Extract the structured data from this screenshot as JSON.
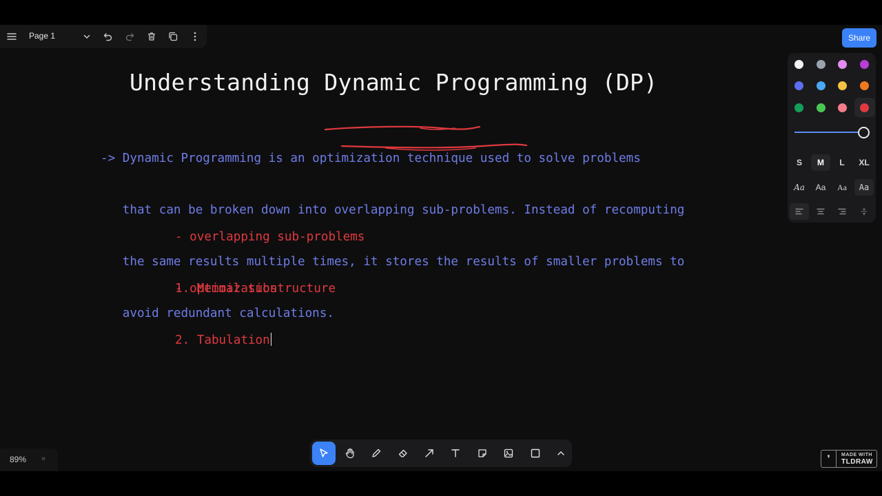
{
  "menu": {
    "page_name": "Page 1"
  },
  "share": {
    "label": "Share"
  },
  "style_panel": {
    "colors": [
      {
        "name": "white",
        "hex": "#f2f2f2"
      },
      {
        "name": "grey",
        "hex": "#9ca3af"
      },
      {
        "name": "light-violet",
        "hex": "#e28cf0"
      },
      {
        "name": "violet",
        "hex": "#b83ed6"
      },
      {
        "name": "blue",
        "hex": "#5e6ef0"
      },
      {
        "name": "light-blue",
        "hex": "#4aa9f5"
      },
      {
        "name": "yellow",
        "hex": "#f5c242"
      },
      {
        "name": "orange",
        "hex": "#f07a1f"
      },
      {
        "name": "green",
        "hex": "#159d5a"
      },
      {
        "name": "light-green",
        "hex": "#4cc653"
      },
      {
        "name": "light-red",
        "hex": "#f47c8a"
      },
      {
        "name": "red",
        "hex": "#e0393e"
      }
    ],
    "selected_color": "red",
    "opacity": 1.0,
    "sizes": [
      "S",
      "M",
      "L",
      "XL"
    ],
    "selected_size": "M",
    "fonts": [
      "Aa",
      "Aa",
      "Aa",
      "Aa"
    ],
    "selected_font_index": 3,
    "alignments": [
      "align-left-icon",
      "align-center-icon",
      "align-right-icon",
      "vertical-align-icon"
    ],
    "selected_alignment_index": 0
  },
  "canvas": {
    "title": "Understanding Dynamic Programming (DP)",
    "paragraph_lines": [
      "-> Dynamic Programming is an optimization technique used to solve problems",
      "   that can be broken down into overlapping sub-problems. Instead of recomputing",
      "   the same results multiple times, it stores the results of smaller problems to",
      "   avoid redundant calculations."
    ],
    "properties": [
      "- overlapping sub-problems",
      "- optimal substructure"
    ],
    "methods": [
      "1. Memoization",
      "2. Tabulation"
    ],
    "text_color": "#6f7ce6",
    "accent_color": "#e0393e"
  },
  "zoom": {
    "level": "89%",
    "expand": "»"
  },
  "toolbar": {
    "tools": [
      {
        "name": "select-tool",
        "icon": "cursor-icon",
        "active": true
      },
      {
        "name": "hand-tool",
        "icon": "hand-icon",
        "active": false
      },
      {
        "name": "draw-tool",
        "icon": "pencil-icon",
        "active": false
      },
      {
        "name": "eraser-tool",
        "icon": "eraser-icon",
        "active": false
      },
      {
        "name": "arrow-tool",
        "icon": "arrow-icon",
        "active": false
      },
      {
        "name": "text-tool",
        "icon": "text-icon",
        "active": false
      },
      {
        "name": "note-tool",
        "icon": "sticky-note-icon",
        "active": false
      },
      {
        "name": "media-tool",
        "icon": "image-icon",
        "active": false
      },
      {
        "name": "rectangle-tool",
        "icon": "rectangle-icon",
        "active": false
      },
      {
        "name": "more-tools",
        "icon": "chevron-up-icon",
        "active": false
      }
    ]
  },
  "badge": {
    "line1": "MADE WITH",
    "line2": "TLDRAW"
  }
}
